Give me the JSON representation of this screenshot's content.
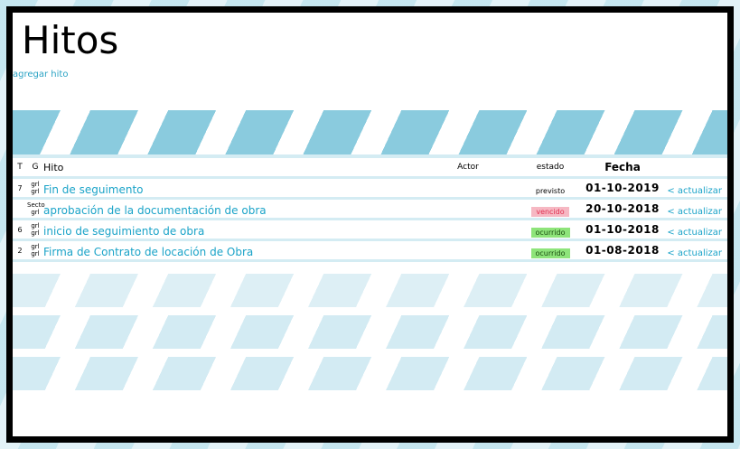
{
  "title": "Hitos",
  "add_link": "agregar hito",
  "columns": {
    "t": "T",
    "g": "G",
    "hito": "Hito",
    "actor": "Actor",
    "estado": "estado",
    "fecha": "Fecha"
  },
  "rows": [
    {
      "t": "7",
      "g1": "grl",
      "g2": "grl",
      "hito": "Fin de seguimento",
      "actor": "",
      "estado": "previsto",
      "estado_type": "previsto",
      "fecha": "01-10-2019",
      "action": "< actualizar"
    },
    {
      "t": "",
      "g1": "Secto",
      "g2": "grl",
      "hito": "aprobación de la documentación de obra",
      "actor": "",
      "estado": "vencido",
      "estado_type": "vencido",
      "fecha": "20-10-2018",
      "action": "< actualizar"
    },
    {
      "t": "6",
      "g1": "grl",
      "g2": "grl",
      "hito": "inicio de seguimiento de obra",
      "actor": "",
      "estado": "ocurrido",
      "estado_type": "ocurrido",
      "fecha": "01-10-2018",
      "action": "< actualizar"
    },
    {
      "t": "2",
      "g1": "grl",
      "g2": "grl",
      "hito": "Firma de Contrato de locación de Obra",
      "actor": "",
      "estado": "ocurrido",
      "estado_type": "ocurrido",
      "fecha": "01-08-2018",
      "action": "< actualizar"
    }
  ],
  "colors": {
    "accent": "#1aa3c8",
    "stripe": "#8acbde",
    "vencido_bg": "#f6b8c3",
    "ocurrido_bg": "#8ee47a"
  }
}
